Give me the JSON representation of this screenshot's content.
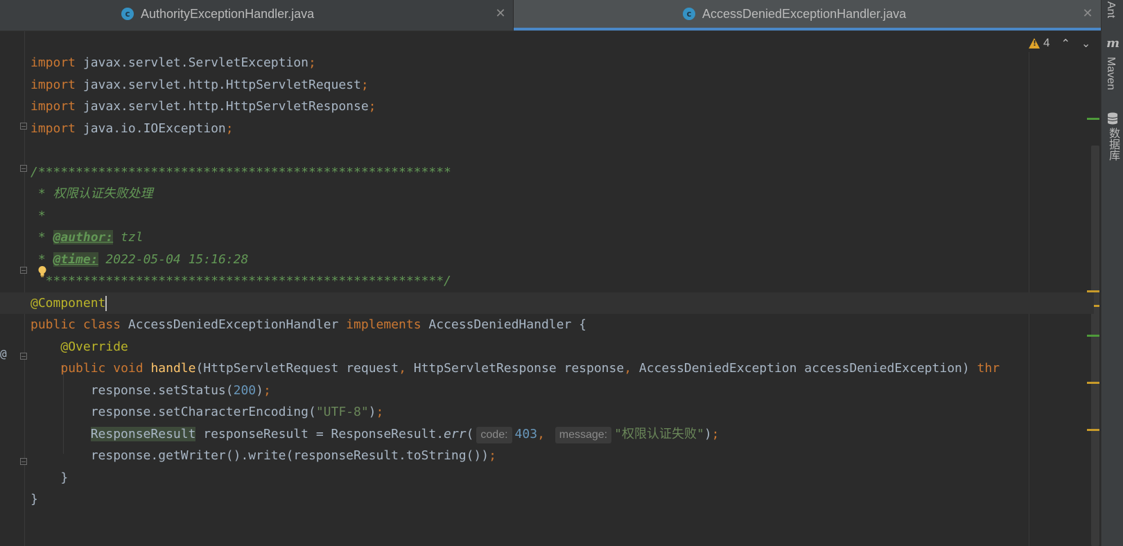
{
  "tabs": [
    {
      "label": "AuthorityExceptionHandler.java",
      "icon": "class-icon",
      "active": false
    },
    {
      "label": "AccessDeniedExceptionHandler.java",
      "icon": "class-icon",
      "active": true
    }
  ],
  "class_icon_letter": "c",
  "close_glyph": "✕",
  "tool_windows": {
    "ant": "Ant",
    "maven": "Maven",
    "database": "数据库"
  },
  "inspections": {
    "warning_count": "4",
    "up_arrow": "⌃",
    "down_arrow": "⌄"
  },
  "gutter": {
    "implements_marker": "@"
  },
  "code": {
    "import1": [
      "import",
      " javax.servlet.ServletException",
      ";"
    ],
    "import2": [
      "import",
      " javax.servlet.http.HttpServletRequest",
      ";"
    ],
    "import3": [
      "import",
      " javax.servlet.http.HttpServletResponse",
      ";"
    ],
    "import4": [
      "import",
      " java.io.IOException",
      ";"
    ],
    "comment_open": "/*******************************************************",
    "comment_desc": " * 权限认证失败处理",
    "comment_blank": " *",
    "author_prefix": " * ",
    "author_tag": "@author:",
    "author_value": " tzl",
    "time_prefix": " * ",
    "time_tag": "@time:",
    "time_value": " 2022-05-04 15:16:28",
    "comment_close": "  *****************************************************/",
    "annotation_component": "@Component",
    "class_kw1": "public",
    "class_kw2": "class",
    "class_name": " AccessDeniedExceptionHandler ",
    "class_kw3": "implements",
    "class_iface": " AccessDeniedHandler {",
    "override": "@Override",
    "m_public": "public",
    "m_void": "void",
    "m_name": "handle",
    "m_p1": "(HttpServletRequest request",
    "m_comma1": ",",
    "m_p2": " HttpServletResponse response",
    "m_comma2": ",",
    "m_p3": " AccessDeniedException accessDeniedException) ",
    "m_throws": "thr",
    "s1_a": "response.setStatus(",
    "s1_num": "200",
    "s1_b": ")",
    "s1_semi": ";",
    "s2_a": "response.setCharacterEncoding(",
    "s2_str": "\"UTF-8\"",
    "s2_b": ")",
    "s2_semi": ";",
    "s3_type": "ResponseResult",
    "s3_a": " responseResult = ResponseResult.",
    "s3_err": "err",
    "s3_paren": "(",
    "s3_hint1": "code:",
    "s3_num": "403",
    "s3_comma": ",",
    "s3_hint2": "message:",
    "s3_str": "\"权限认证失败\"",
    "s3_b": ")",
    "s3_semi": ";",
    "s4_a": "response.getWriter().write(responseResult.toString())",
    "s4_semi": ";",
    "close_method": "}",
    "close_class": "}"
  },
  "colors": {
    "background": "#2b2b2b",
    "keyword": "#cc7832",
    "annotation": "#bbb529",
    "number": "#6897bb",
    "string": "#6a8759",
    "comment": "#629755",
    "function": "#ffc66d",
    "accent": "#4a88c7"
  }
}
